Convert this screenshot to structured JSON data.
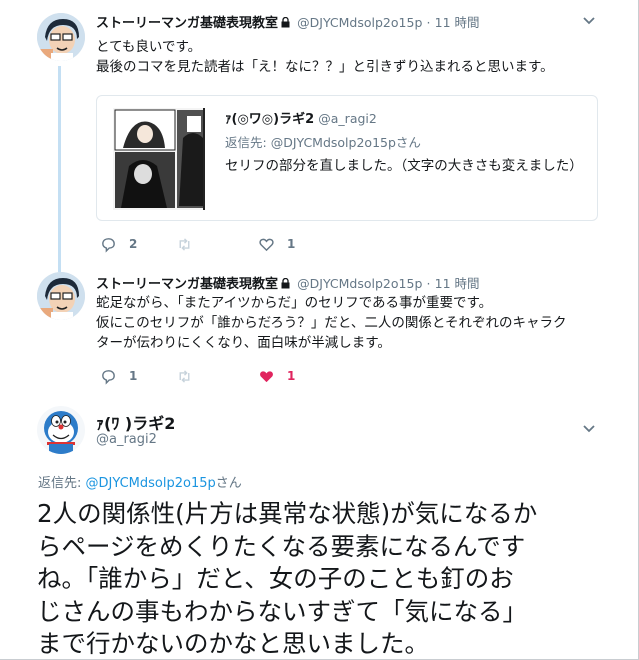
{
  "tweet1": {
    "name": "ストーリーマンガ基礎表現教室",
    "handle": "@DJYCMdsolp2o15p",
    "separator": "·",
    "time": "11 時間",
    "lines": [
      "とても良いです。",
      "最後のコマを見た読者は「え！なに？？」と引きずり込まれると思います。"
    ],
    "quote": {
      "name": "ｧ(◎ワ◎)ラギ2",
      "handle": "@a_ragi2",
      "reply_prefix": "返信先: ",
      "reply_handle": "@DJYCMdsolp2o15p",
      "reply_suffix": "さん",
      "text": "セリフの部分を直しました。（文字の大きさも変えました）"
    },
    "replies": "2",
    "likes": "1"
  },
  "tweet2": {
    "name": "ストーリーマンガ基礎表現教室",
    "handle": "@DJYCMdsolp2o15p",
    "separator": "·",
    "time": "11 時間",
    "lines": [
      "蛇足ながら、「またアイツからだ」のセリフである事が重要です。",
      "仮にこのセリフが「誰からだろう？」だと、二人の関係とそれぞれのキャラク",
      "ターが伝わりにくくなり、面白味が半減します。"
    ],
    "replies": "1",
    "likes": "1"
  },
  "main": {
    "name": "ｧ(ﾜ )ラギ2",
    "handle": "@a_ragi2",
    "reply_prefix": "返信先: ",
    "reply_handle": "@DJYCMdsolp2o15p",
    "reply_suffix": "さん",
    "lines": [
      "2人の関係性(片方は異常な状態)が気になるか",
      "らページをめくりたくなる要素になるんです",
      "ね。「誰から」だと、女の子のことも釘のお",
      "じさんの事もわからないすぎて「気になる」",
      "まで行かないのかなと思いました。"
    ]
  },
  "colors": {
    "accent": "#1b95e0",
    "like": "#e0245e",
    "thread": "#c4dff3",
    "muted": "#657786"
  },
  "icons": [
    "lock-icon",
    "chevron-down-icon",
    "reply-icon",
    "retweet-icon",
    "heart-icon"
  ]
}
